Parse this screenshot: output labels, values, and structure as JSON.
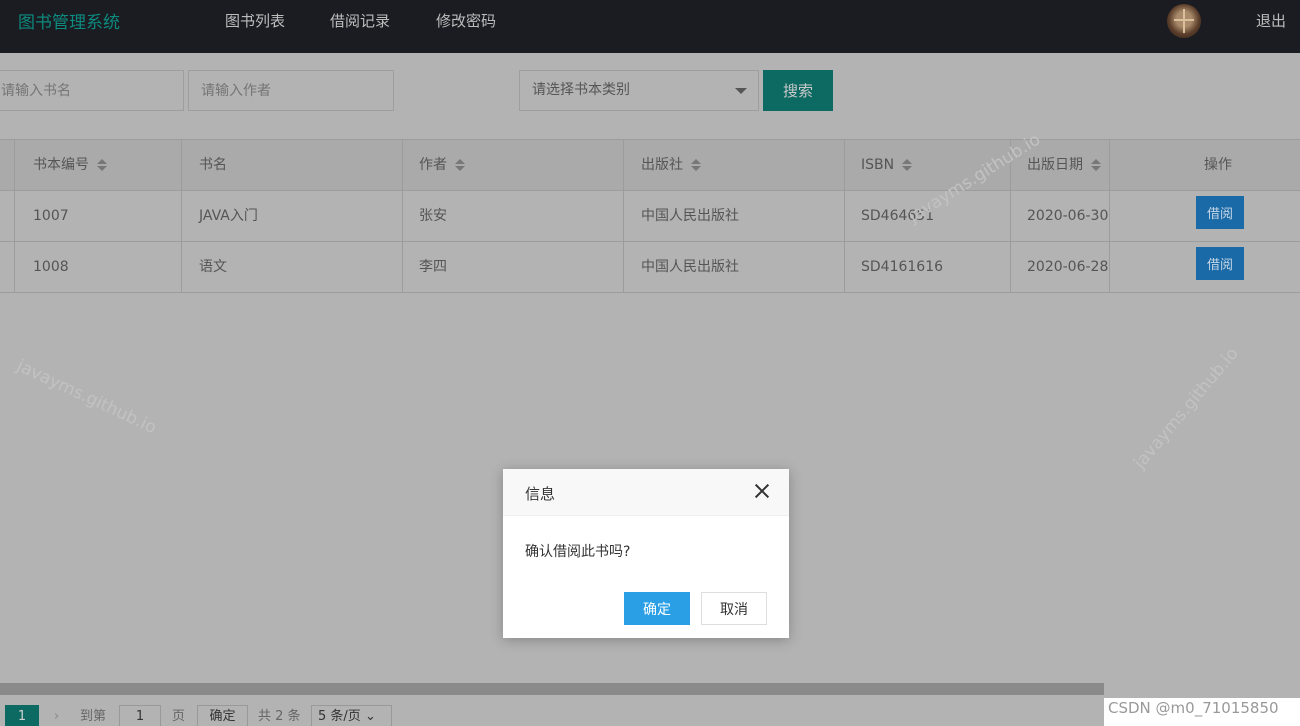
{
  "header": {
    "logo": "图书管理系统",
    "nav": [
      "图书列表",
      "借阅记录",
      "修改密码"
    ],
    "logout": "退出",
    "colors": {
      "background": "#1a1c22",
      "logo": "#0d8a7e"
    }
  },
  "filters": {
    "book_name_placeholder": "请输入书名",
    "author_placeholder": "请输入作者",
    "category_placeholder": "请选择书本类别",
    "search_label": "搜索"
  },
  "table": {
    "columns": [
      "书本编号",
      "书名",
      "作者",
      "出版社",
      "ISBN",
      "出版日期",
      "操作"
    ],
    "rows": [
      {
        "id": "1007",
        "name": "JAVA入门",
        "author": "张安",
        "publisher": "中国人民出版社",
        "isbn": "SD464651",
        "date": "2020-06-30",
        "action": "借阅"
      },
      {
        "id": "1008",
        "name": "语文",
        "author": "李四",
        "publisher": "中国人民出版社",
        "isbn": "SD4161616",
        "date": "2020-06-28",
        "action": "借阅"
      }
    ]
  },
  "pagination": {
    "current": "1",
    "goto_label": "到第",
    "goto_value": "1",
    "page_label": "页",
    "confirm_label": "确定",
    "total": "共 2 条",
    "page_size": "5 条/页"
  },
  "dialog": {
    "title": "信息",
    "message": "确认借阅此书吗?",
    "ok_label": "确定",
    "cancel_label": "取消"
  },
  "watermark": "javayms.github.io",
  "csdn_mark": "CSDN @m0_71015850"
}
